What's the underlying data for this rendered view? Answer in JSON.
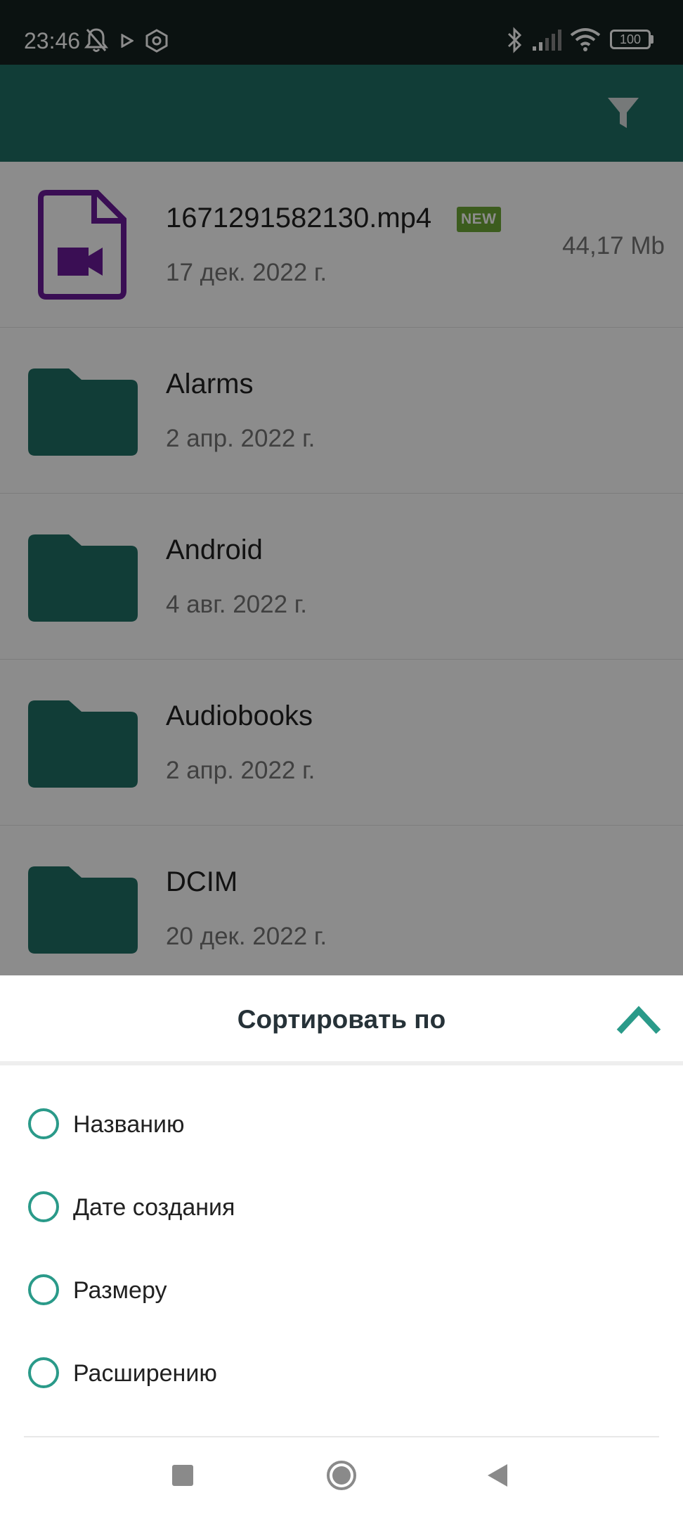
{
  "status_bar": {
    "time": "23:46",
    "battery": "100",
    "icons": [
      "bell-off-icon",
      "play-icon",
      "hexagon-icon",
      "bluetooth-icon",
      "signal-icon",
      "wifi-icon",
      "battery-icon"
    ]
  },
  "app_bar": {
    "action_icon": "filter-icon"
  },
  "files": [
    {
      "name": "1671291582130.mp4",
      "date": "17 дек. 2022 г.",
      "size": "44,17 Mb",
      "badge": "NEW",
      "type": "video"
    },
    {
      "name": "Alarms",
      "date": "2 апр. 2022 г.",
      "type": "folder"
    },
    {
      "name": "Android",
      "date": "4 авг. 2022 г.",
      "type": "folder"
    },
    {
      "name": "Audiobooks",
      "date": "2 апр. 2022 г.",
      "type": "folder"
    },
    {
      "name": "DCIM",
      "date": "20 дек. 2022 г.",
      "type": "folder"
    }
  ],
  "sort_sheet": {
    "title": "Сортировать по",
    "options": [
      {
        "label": "Названию"
      },
      {
        "label": "Дате создания"
      },
      {
        "label": "Размеру"
      },
      {
        "label": "Расширению"
      }
    ]
  },
  "nav_bar": {
    "buttons": [
      "recents-icon",
      "home-icon",
      "back-icon"
    ]
  },
  "colors": {
    "accent": "#2a9a89",
    "app_bar": "#1f6f64",
    "folder": "#1f6f64",
    "video_file": "#6a1b9a",
    "badge": "#6ea838"
  }
}
